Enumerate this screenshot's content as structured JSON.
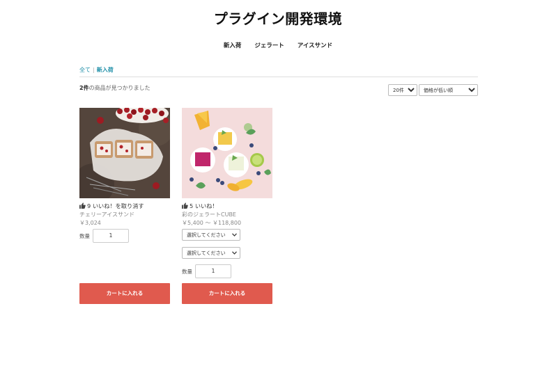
{
  "site": {
    "title": "プラグイン開発環境"
  },
  "nav": {
    "items": [
      "新入荷",
      "ジェラート",
      "アイスサンド"
    ]
  },
  "breadcrumb": {
    "all": "全て",
    "separator": "|",
    "current": "新入荷"
  },
  "results": {
    "count": "2件",
    "suffix": "の商品が見つかりました"
  },
  "controls": {
    "per_page": "20件",
    "sort": "価格が低い順"
  },
  "products": [
    {
      "likes": "9",
      "like_text": "いいね！を取り消す",
      "name": "チェリーアイスサンド",
      "price": "￥3,024",
      "qty_label": "数量",
      "qty_value": "1",
      "cart_label": "カートに入れる"
    },
    {
      "likes": "5",
      "like_text": "いいね！",
      "name": "彩のジェラートCUBE",
      "price": "￥5,400 ～ ￥118,800",
      "option1": "選択してください",
      "option2": "選択してください",
      "qty_label": "数量",
      "qty_value": "1",
      "cart_label": "カートに入れる"
    }
  ],
  "colors": {
    "accent": "#1f8fa8",
    "cart_button": "#e05a4e"
  },
  "icons": {
    "like": "thumbs-up-icon",
    "dropdown": "chevron-down-icon"
  }
}
